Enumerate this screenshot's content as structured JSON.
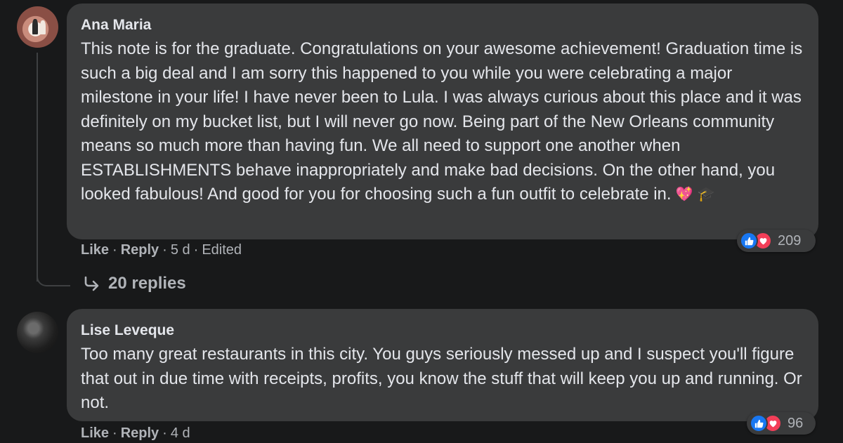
{
  "comments": [
    {
      "author": "Ana Maria",
      "text": "This note is for the graduate. Congratulations on your awesome achievement! Graduation time is such a big deal and I am sorry this happened to you while you were celebrating a major milestone in your life! I have never been to Lula. I was always curious about this place and it was definitely on my bucket list, but I will never go now. Being part of the New Orleans community means so much more than having fun. We all need to support one another when ESTABLISHMENTS behave inappropriately and make bad decisions. On the other hand, you looked fabulous! And good for you for choosing such a fun outfit to celebrate in.",
      "emojis": [
        "💖",
        "🎓"
      ],
      "reaction_count": "209",
      "actions": {
        "like": "Like",
        "reply": "Reply",
        "time": "5 d",
        "edited": "Edited"
      },
      "replies_label": "20 replies"
    },
    {
      "author": "Lise Leveque",
      "text": "Too many great restaurants in this city. You guys seriously messed up and I suspect you'll figure that out in due time with receipts, profits, you know the stuff that will keep you up and running. Or not.",
      "reaction_count": "96",
      "actions": {
        "like": "Like",
        "reply": "Reply",
        "time": "4 d"
      }
    }
  ],
  "colors": {
    "background": "#18191a",
    "bubble": "#3a3b3c",
    "text": "#e4e6eb",
    "secondary_text": "#b0b3b8",
    "like_blue": "#1877f2",
    "love_red": "#f33e58"
  },
  "icons": [
    "like-icon",
    "love-icon",
    "reply-arrow-icon"
  ]
}
